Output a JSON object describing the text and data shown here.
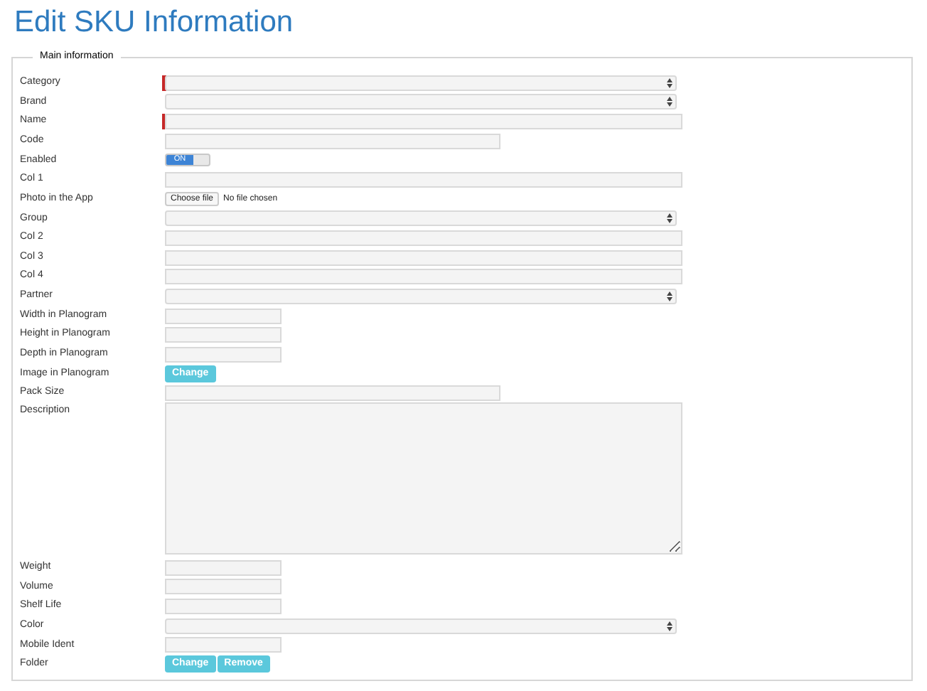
{
  "title": "Edit SKU Information",
  "section": {
    "legend": "Main information",
    "rows": [
      {
        "label": "Category",
        "kind": "select",
        "required": true
      },
      {
        "label": "Brand",
        "kind": "select",
        "required": false
      },
      {
        "label": "Name",
        "kind": "wide",
        "required": true
      },
      {
        "label": "Code",
        "kind": "medium",
        "required": false
      },
      {
        "label": "Enabled",
        "kind": "toggle",
        "on": true,
        "text": "ON"
      },
      {
        "label": "Col 1",
        "kind": "wide",
        "required": false
      },
      {
        "label": "Photo in the App",
        "kind": "file",
        "button": "Choose file",
        "status": "No file chosen"
      },
      {
        "label": "Group",
        "kind": "select",
        "required": false
      },
      {
        "label": "Col 2",
        "kind": "wide",
        "required": false
      },
      {
        "label": "Col 3",
        "kind": "wide",
        "required": false
      },
      {
        "label": "Col 4",
        "kind": "wide",
        "required": false
      },
      {
        "label": "Partner",
        "kind": "select",
        "required": false
      },
      {
        "label": "Width in Planogram",
        "kind": "narrow",
        "required": false
      },
      {
        "label": "Height in Planogram",
        "kind": "narrow",
        "required": false
      },
      {
        "label": "Depth in Planogram",
        "kind": "narrow",
        "required": false
      },
      {
        "label": "Image in Planogram",
        "kind": "buttons",
        "buttons": [
          "Change"
        ]
      },
      {
        "label": "Pack Size",
        "kind": "medium",
        "required": false
      },
      {
        "label": "Description",
        "kind": "textarea",
        "required": false
      },
      {
        "label": "Weight",
        "kind": "narrow",
        "required": false
      },
      {
        "label": "Volume",
        "kind": "narrow",
        "required": false
      },
      {
        "label": "Shelf Life",
        "kind": "narrow",
        "required": false
      },
      {
        "label": "Color",
        "kind": "select",
        "required": false
      },
      {
        "label": "Mobile Ident",
        "kind": "narrow",
        "required": false
      },
      {
        "label": "Folder",
        "kind": "buttons",
        "buttons": [
          "Change",
          "Remove"
        ]
      }
    ]
  }
}
